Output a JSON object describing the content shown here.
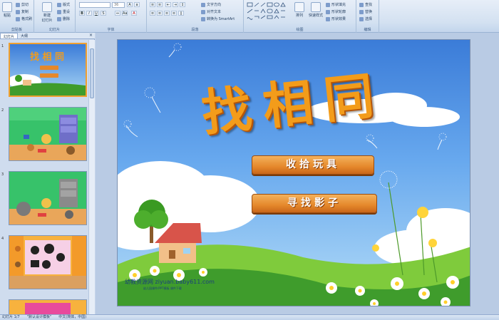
{
  "ribbon": {
    "groups": {
      "clipboard": {
        "label": "剪贴板",
        "paste": "粘贴",
        "cut": "剪切",
        "copy": "复制",
        "format_painter": "格式刷"
      },
      "slides": {
        "label": "幻灯片",
        "new_slide": "新建\n幻灯片",
        "layout": "版式",
        "reset": "重设",
        "delete": "删除"
      },
      "font": {
        "label": "字体",
        "font_name": "",
        "font_size": "36"
      },
      "paragraph": {
        "label": "段落",
        "text_direction": "文字方向",
        "align_text": "对齐文本",
        "smartart": "转换为 SmartArt"
      },
      "drawing": {
        "label": "绘图",
        "arrange": "排列",
        "quick_styles": "快速样式",
        "shape_fill": "形状填充",
        "shape_outline": "形状轮廓",
        "shape_effects": "形状效果"
      },
      "editing": {
        "label": "编辑",
        "find": "查找",
        "replace": "替换",
        "select": "选择"
      }
    }
  },
  "panel": {
    "tabs": [
      "幻灯片",
      "大纲"
    ],
    "close": "×",
    "slide_numbers": [
      "1",
      "2",
      "3",
      "4"
    ]
  },
  "slide": {
    "title": "找相同",
    "buttons": [
      "收拾玩具",
      "寻找影子"
    ],
    "watermark": "幼教资源网 ziyuan.baby611.com",
    "watermark_sub": "幼儿园课件/PPT模板 课件下载"
  },
  "statusbar": {
    "slide_info": "幻灯片 1/7",
    "theme": "\"默认设计模板\"",
    "language": "中文(简体，中国)"
  },
  "colors": {
    "title": "#f39c1a",
    "button": "#e5882b",
    "sky": "#3b7cd8",
    "grass": "#3f9c2c"
  }
}
